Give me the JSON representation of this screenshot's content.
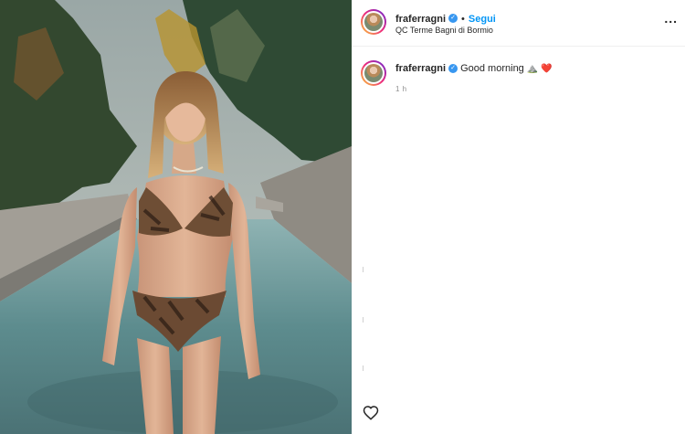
{
  "post": {
    "username": "fraferragni",
    "verified_icon": "verified-badge-icon",
    "separator": "•",
    "follow_label": "Segui",
    "location": "QC Terme Bagni di Bormio",
    "more_label": "...",
    "caption_text": "Good morning",
    "caption_emoji": "⛰️ ❤️",
    "timestamp": "1 h",
    "like_icon": "heart-icon"
  },
  "colors": {
    "accent": "#0095f6",
    "verified": "#3897f0",
    "text": "#262626",
    "muted": "#8e8e8e"
  }
}
